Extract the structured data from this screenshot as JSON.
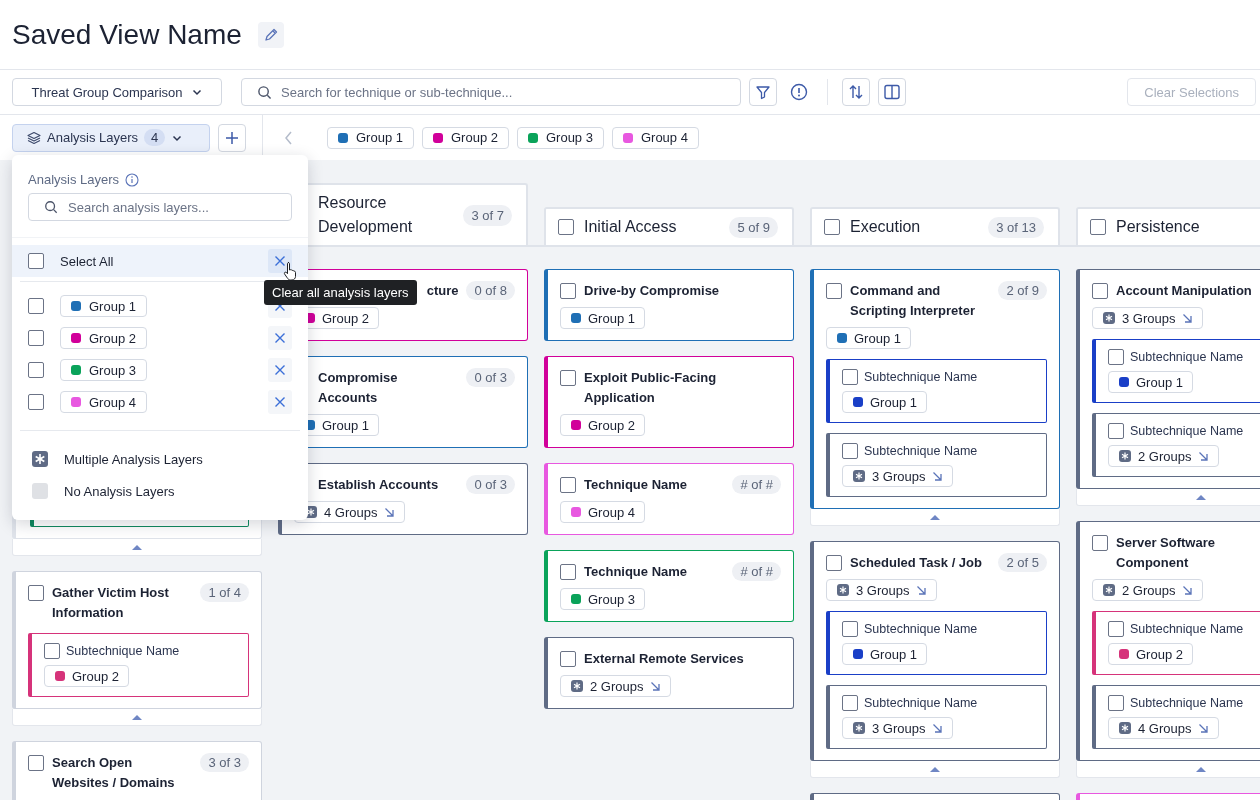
{
  "title": "Saved View Name",
  "toolbar": {
    "view_select": "Threat Group Comparison",
    "search": {
      "placeholder": "Search for technique or sub-technique..."
    },
    "clear_button": {
      "label": "Clear Selections",
      "disabled": true
    }
  },
  "layers_bar": {
    "button": {
      "label": "Analysis Layers",
      "count": "4",
      "expanded": true
    },
    "chips": [
      {
        "label": "Group 1",
        "color": "#1f6fb5"
      },
      {
        "label": "Group 2",
        "color": "#d1009a"
      },
      {
        "label": "Group 3",
        "color": "#0aa35a"
      },
      {
        "label": "Group 4",
        "color": "#e858e0"
      }
    ]
  },
  "layers_panel": {
    "heading": "Analysis Layers",
    "search": {
      "placeholder": "Search analysis layers..."
    },
    "select_all": {
      "label": "Select All",
      "checked": false,
      "hovered": true
    },
    "layers": [
      {
        "label": "Group 1",
        "color": "#1f6fb5",
        "checked": false
      },
      {
        "label": "Group 2",
        "color": "#d1009a",
        "checked": false
      },
      {
        "label": "Group 3",
        "color": "#0aa35a",
        "checked": false
      },
      {
        "label": "Group 4",
        "color": "#e858e0",
        "checked": false
      }
    ],
    "legend": [
      {
        "kind": "multiple",
        "label": "Multiple Analysis Layers"
      },
      {
        "kind": "none",
        "label": "No Analysis Layers"
      }
    ]
  },
  "tooltip": "Clear all analysis layers",
  "columns": [
    {
      "cards": [
        {
          "kind": "covered",
          "subs": [
            {
              "color": "#0f8a5f"
            }
          ]
        },
        {
          "kind": "technique",
          "title": "Gather Victim Host Information",
          "count": "1 of 4",
          "checked": false,
          "color": "#cfd4de",
          "subs": [
            {
              "title": "Subtechnique Name",
              "checked": false,
              "color": "#d6337a",
              "tags": [
                {
                  "kind": "group",
                  "label": "Group 2",
                  "color": "#d6337a"
                }
              ]
            }
          ]
        },
        {
          "kind": "technique",
          "title": "Search Open Websites / Domains",
          "count": "3 of 3",
          "checked": false,
          "color": "#cfd4de"
        }
      ]
    },
    {
      "title": "Resource Development",
      "count": "3 of 7",
      "cards": [
        {
          "kind": "technique",
          "title": "cture",
          "cut_left": true,
          "count": "0 of 8",
          "color": "#d1009a",
          "tags": [
            {
              "kind": "group",
              "label": "Group 2",
              "color": "#d1009a"
            }
          ]
        },
        {
          "kind": "technique",
          "title": "Compromise Accounts",
          "count": "0 of 3",
          "color": "#1f6fb5",
          "tags": [
            {
              "kind": "group",
              "label": "Group 1",
              "color": "#1f6fb5"
            }
          ]
        },
        {
          "kind": "technique",
          "title": "Establish Accounts",
          "count": "0 of 3",
          "color": "#5f6b85",
          "tags": [
            {
              "kind": "multi",
              "label": "4 Groups"
            }
          ]
        }
      ]
    },
    {
      "title": "Initial Access",
      "count": "5 of 9",
      "checked": false,
      "cards": [
        {
          "kind": "technique",
          "title": "Drive-by Compromise",
          "checked": false,
          "color": "#1f6fb5",
          "tags": [
            {
              "kind": "group",
              "label": "Group 1",
              "color": "#1f6fb5"
            }
          ]
        },
        {
          "kind": "technique",
          "title": "Exploit Public-Facing Application",
          "checked": false,
          "color": "#d1009a",
          "tags": [
            {
              "kind": "group",
              "label": "Group 2",
              "color": "#d1009a"
            }
          ]
        },
        {
          "kind": "technique",
          "title": "Technique Name",
          "count": "# of #",
          "checked": false,
          "color": "#e858e0",
          "tags": [
            {
              "kind": "group",
              "label": "Group 4",
              "color": "#e858e0"
            }
          ]
        },
        {
          "kind": "technique",
          "title": "Technique Name",
          "count": "# of #",
          "checked": false,
          "color": "#0aa35a",
          "tags": [
            {
              "kind": "group",
              "label": "Group 3",
              "color": "#0aa35a"
            }
          ]
        },
        {
          "kind": "technique",
          "title": "External  Remote Services",
          "checked": false,
          "color": "#5f6b85",
          "tags": [
            {
              "kind": "multi",
              "label": "2 Groups"
            }
          ]
        }
      ]
    },
    {
      "title": "Execution",
      "count": "3 of 13",
      "checked": false,
      "cards": [
        {
          "kind": "technique",
          "title": "Command and Scripting Interpreter",
          "count": "2 of 9",
          "checked": false,
          "color": "#1f6fb5",
          "tags": [
            {
              "kind": "group",
              "label": "Group 1",
              "color": "#1f6fb5"
            }
          ],
          "subs": [
            {
              "title": "Subtechnique Name",
              "checked": false,
              "color": "#1a3fc7",
              "tags": [
                {
                  "kind": "group",
                  "label": "Group 1",
                  "color": "#1a3fc7"
                }
              ]
            },
            {
              "title": "Subtechnique Name",
              "checked": false,
              "color": "#5f6b85",
              "tags": [
                {
                  "kind": "multi",
                  "label": "3 Groups"
                }
              ]
            }
          ]
        },
        {
          "kind": "technique",
          "title": "Scheduled Task / Job",
          "count": "2 of 5",
          "checked": false,
          "color": "#5f6b85",
          "tags": [
            {
              "kind": "multi",
              "label": "3 Groups"
            }
          ],
          "subs": [
            {
              "title": "Subtechnique Name",
              "checked": false,
              "color": "#1a3fc7",
              "tags": [
                {
                  "kind": "group",
                  "label": "Group 1",
                  "color": "#1a3fc7"
                }
              ]
            },
            {
              "title": "Subtechnique Name",
              "checked": false,
              "color": "#5f6b85",
              "tags": [
                {
                  "kind": "multi",
                  "label": "3 Groups"
                }
              ]
            }
          ]
        },
        {
          "kind": "stub",
          "color": "#5f6b85"
        }
      ]
    },
    {
      "title": "Persistence",
      "checked": false,
      "cards": [
        {
          "kind": "technique",
          "title": "Account Manipulation",
          "checked": false,
          "color": "#5f6b85",
          "tags": [
            {
              "kind": "multi",
              "label": "3 Groups"
            }
          ],
          "subs": [
            {
              "title": "Subtechnique Name",
              "checked": false,
              "color": "#1a3fc7",
              "tags": [
                {
                  "kind": "group",
                  "label": "Group 1",
                  "color": "#1a3fc7"
                }
              ]
            },
            {
              "title": "Subtechnique Name",
              "checked": false,
              "color": "#5f6b85",
              "tags": [
                {
                  "kind": "multi",
                  "label": "2 Groups"
                }
              ]
            }
          ]
        },
        {
          "kind": "technique",
          "title": "Server Software Component",
          "checked": false,
          "color": "#5f6b85",
          "tags": [
            {
              "kind": "multi",
              "label": "2 Groups"
            }
          ],
          "subs": [
            {
              "title": "Subtechnique Name",
              "checked": false,
              "color": "#d6337a",
              "tags": [
                {
                  "kind": "group",
                  "label": "Group 2",
                  "color": "#d6337a"
                }
              ]
            },
            {
              "title": "Subtechnique Name",
              "checked": false,
              "color": "#5f6b85",
              "tags": [
                {
                  "kind": "multi",
                  "label": "4 Groups"
                }
              ]
            }
          ]
        },
        {
          "kind": "stub",
          "color": "#e858e0"
        }
      ]
    }
  ]
}
